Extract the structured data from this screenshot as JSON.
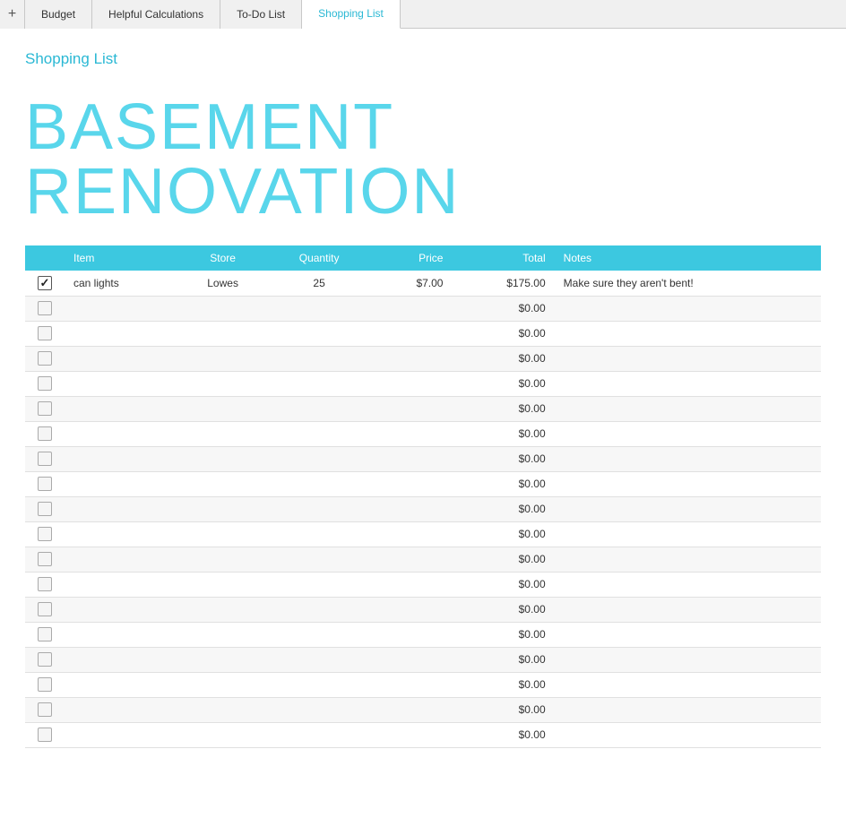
{
  "tabs": [
    {
      "id": "budget",
      "label": "Budget",
      "active": false
    },
    {
      "id": "helpful-calculations",
      "label": "Helpful Calculations",
      "active": false
    },
    {
      "id": "to-do-list",
      "label": "To-Do List",
      "active": false
    },
    {
      "id": "shopping-list",
      "label": "Shopping List",
      "active": true
    }
  ],
  "add_tab_icon": "+",
  "page_title": "Shopping List",
  "renovation_title": "BASEMENT RENOVATION",
  "table": {
    "columns": [
      {
        "id": "checked",
        "label": ""
      },
      {
        "id": "item",
        "label": "Item"
      },
      {
        "id": "store",
        "label": "Store"
      },
      {
        "id": "quantity",
        "label": "Quantity"
      },
      {
        "id": "price",
        "label": "Price"
      },
      {
        "id": "total",
        "label": "Total"
      },
      {
        "id": "notes",
        "label": "Notes"
      }
    ],
    "rows": [
      {
        "checked": true,
        "item": "can lights",
        "store": "Lowes",
        "quantity": "25",
        "price": "$7.00",
        "total": "$175.00",
        "notes": "Make sure they aren't bent!"
      },
      {
        "checked": false,
        "item": "",
        "store": "",
        "quantity": "",
        "price": "",
        "total": "$0.00",
        "notes": ""
      },
      {
        "checked": false,
        "item": "",
        "store": "",
        "quantity": "",
        "price": "",
        "total": "$0.00",
        "notes": ""
      },
      {
        "checked": false,
        "item": "",
        "store": "",
        "quantity": "",
        "price": "",
        "total": "$0.00",
        "notes": ""
      },
      {
        "checked": false,
        "item": "",
        "store": "",
        "quantity": "",
        "price": "",
        "total": "$0.00",
        "notes": ""
      },
      {
        "checked": false,
        "item": "",
        "store": "",
        "quantity": "",
        "price": "",
        "total": "$0.00",
        "notes": ""
      },
      {
        "checked": false,
        "item": "",
        "store": "",
        "quantity": "",
        "price": "",
        "total": "$0.00",
        "notes": ""
      },
      {
        "checked": false,
        "item": "",
        "store": "",
        "quantity": "",
        "price": "",
        "total": "$0.00",
        "notes": ""
      },
      {
        "checked": false,
        "item": "",
        "store": "",
        "quantity": "",
        "price": "",
        "total": "$0.00",
        "notes": ""
      },
      {
        "checked": false,
        "item": "",
        "store": "",
        "quantity": "",
        "price": "",
        "total": "$0.00",
        "notes": ""
      },
      {
        "checked": false,
        "item": "",
        "store": "",
        "quantity": "",
        "price": "",
        "total": "$0.00",
        "notes": ""
      },
      {
        "checked": false,
        "item": "",
        "store": "",
        "quantity": "",
        "price": "",
        "total": "$0.00",
        "notes": ""
      },
      {
        "checked": false,
        "item": "",
        "store": "",
        "quantity": "",
        "price": "",
        "total": "$0.00",
        "notes": ""
      },
      {
        "checked": false,
        "item": "",
        "store": "",
        "quantity": "",
        "price": "",
        "total": "$0.00",
        "notes": ""
      },
      {
        "checked": false,
        "item": "",
        "store": "",
        "quantity": "",
        "price": "",
        "total": "$0.00",
        "notes": ""
      },
      {
        "checked": false,
        "item": "",
        "store": "",
        "quantity": "",
        "price": "",
        "total": "$0.00",
        "notes": ""
      },
      {
        "checked": false,
        "item": "",
        "store": "",
        "quantity": "",
        "price": "",
        "total": "$0.00",
        "notes": ""
      },
      {
        "checked": false,
        "item": "",
        "store": "",
        "quantity": "",
        "price": "",
        "total": "$0.00",
        "notes": ""
      },
      {
        "checked": false,
        "item": "",
        "store": "",
        "quantity": "",
        "price": "",
        "total": "$0.00",
        "notes": ""
      }
    ]
  }
}
